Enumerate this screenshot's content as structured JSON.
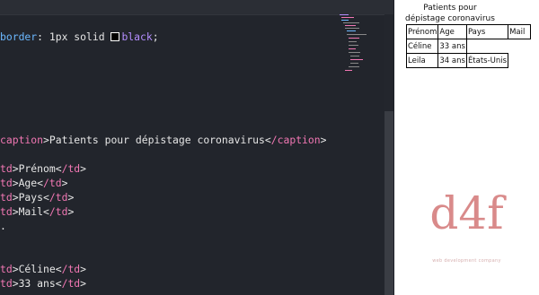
{
  "editor": {
    "css_line": {
      "prop": "border",
      "value_prefix": ": 1px solid ",
      "color_word": "black",
      "end": ";"
    },
    "caption_line": {
      "open_tag": "caption",
      "text": "Patients pour dépistage coronavirus",
      "close_tag": "/caption"
    },
    "header_cells": [
      "Prénom",
      "Age",
      "Pays",
      "Mail"
    ],
    "row_cells": [
      "Céline",
      "33 ans"
    ],
    "cell_tag": "td",
    "cell_close_tag": "/td"
  },
  "preview": {
    "caption": "Patients pour dépistage coronavirus",
    "headers": [
      "Prénom",
      "Age",
      "Pays",
      "Mail"
    ],
    "rows": [
      [
        "Céline",
        "33 ans",
        "",
        ""
      ],
      [
        "Leila",
        "34 ans",
        "États-Unis",
        ""
      ]
    ],
    "logo": "d4f",
    "logo_sub": "web development company"
  },
  "colors": {
    "tag": "#f177b3",
    "property": "#6bb8ff",
    "value": "#b48eff",
    "logo": "#d98a8a"
  }
}
